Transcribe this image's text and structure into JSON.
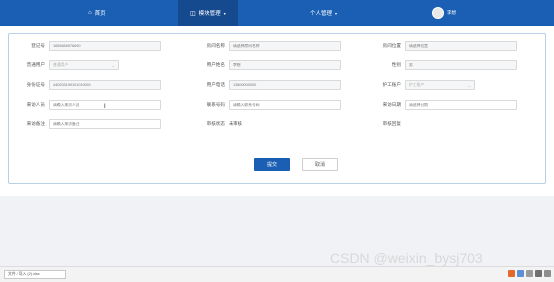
{
  "nav": {
    "home": "首页",
    "module": "模块管理",
    "personal": "个人管理",
    "user": "李想"
  },
  "form": {
    "registration_no": {
      "label": "登记号",
      "placeholder": "1655846976690"
    },
    "room_name": {
      "label": "房间名称",
      "placeholder": "请选择房间名称"
    },
    "room_location": {
      "label": "房间位置",
      "placeholder": "请选择位置"
    },
    "ordinary_user": {
      "label": "普通用户",
      "value": "普通用户"
    },
    "user_name": {
      "label": "用户姓名",
      "placeholder": "李想"
    },
    "gender": {
      "label": "性别",
      "placeholder": "男"
    },
    "id_card": {
      "label": "身份证号",
      "placeholder": "440203199101010001"
    },
    "phone": {
      "label": "用户电话",
      "placeholder": "13800000000"
    },
    "nurse_account": {
      "label": "护工账户",
      "value": "护工账户"
    },
    "visitor": {
      "label": "来访人员",
      "placeholder": "请输入来访人员"
    },
    "contact_phone": {
      "label": "联系号码",
      "placeholder": "请输入联系号码"
    },
    "visit_date": {
      "label": "来访日期",
      "placeholder": "请选择日期"
    },
    "visit_remark": {
      "label": "来访备注",
      "placeholder": "请输入来访备注"
    },
    "audit_status": {
      "label": "审核状态",
      "value": "未审核"
    },
    "audit_reply": {
      "label": "审核回复",
      "value": ""
    }
  },
  "buttons": {
    "submit": "提交",
    "cancel": "取消"
  },
  "taskbar": {
    "tab": "文件 / 导入 (2).xlsx"
  },
  "watermark": "CSDN @weixin_bysj703",
  "colors": {
    "primary": "#1a5fb4",
    "card_border": "#b9cfe5"
  }
}
